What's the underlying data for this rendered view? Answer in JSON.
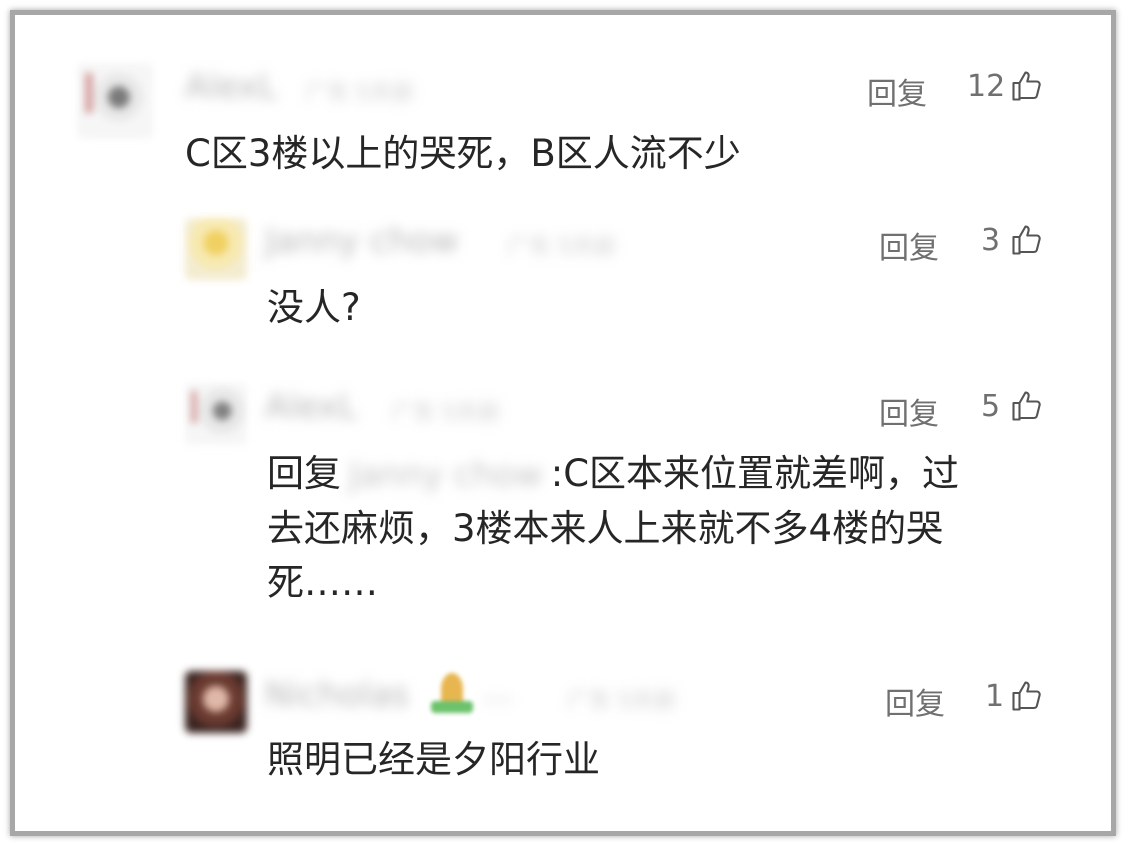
{
  "comments": [
    {
      "username": "AlexL",
      "meta": "广东 5天前",
      "reply_label": "回复",
      "likes": "12",
      "text": "C区3楼以上的哭死，B区人流不少"
    },
    {
      "username": "Janny chow",
      "meta": "广东 5天前",
      "reply_label": "回复",
      "likes": "3",
      "text": "没人?"
    },
    {
      "username": "AlexL",
      "meta": "广东 5天前",
      "reply_label": "回复",
      "likes": "5",
      "text_prefix": "回复",
      "mention": "Janny chow",
      "text_line1": ":C区本来位置就差啊，过",
      "text_line2": "去还麻烦，3楼本来人上来就不多4楼的哭",
      "text_line3": "死……"
    },
    {
      "username": "Nicholas",
      "username_suffix": "…",
      "meta": "广东 5天前",
      "reply_label": "回复",
      "likes": "1",
      "text": "照明已经是夕阳行业"
    }
  ],
  "colors": {
    "text": "#262626",
    "secondary": "#707070",
    "frame": "#a7a7a7"
  },
  "icons": [
    "thumbs-up-icon",
    "avatar"
  ]
}
